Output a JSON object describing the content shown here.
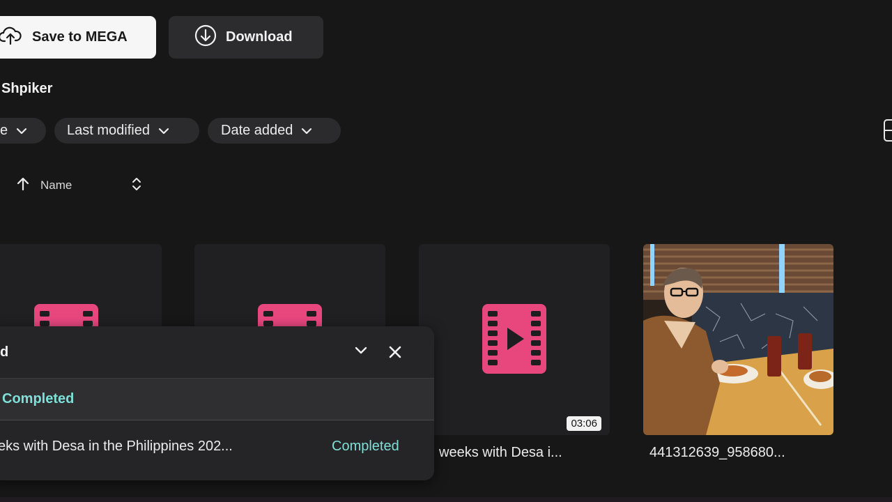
{
  "toolbar": {
    "save_label": "Save to MEGA",
    "download_label": "Download"
  },
  "folder": {
    "owner": "Shpiker"
  },
  "filters": [
    {
      "label": "e"
    },
    {
      "label": "Last modified"
    },
    {
      "label": "Date added"
    }
  ],
  "sort": {
    "column": "Name",
    "direction": "ascending"
  },
  "files": [
    {
      "type": "video",
      "name": ""
    },
    {
      "type": "video",
      "name": ""
    },
    {
      "type": "video",
      "name": "weeks with Desa i...",
      "duration": "03:06"
    },
    {
      "type": "image",
      "name": "441312639_958680..."
    }
  ],
  "transfer_panel": {
    "title": "d",
    "summary_status": "Completed",
    "items": [
      {
        "name": "eks with Desa in the Philippines 202...",
        "status": "Completed"
      }
    ]
  },
  "colors": {
    "background": "#171718",
    "accent_pink": "#e8477e",
    "completed_teal": "#7fe0d9"
  },
  "icons": [
    "cloud-upload-icon",
    "download-circle-icon",
    "chevron-down-icon",
    "arrow-up-icon",
    "sort-updown-icon",
    "grid-view-icon",
    "film-icon",
    "close-icon"
  ]
}
